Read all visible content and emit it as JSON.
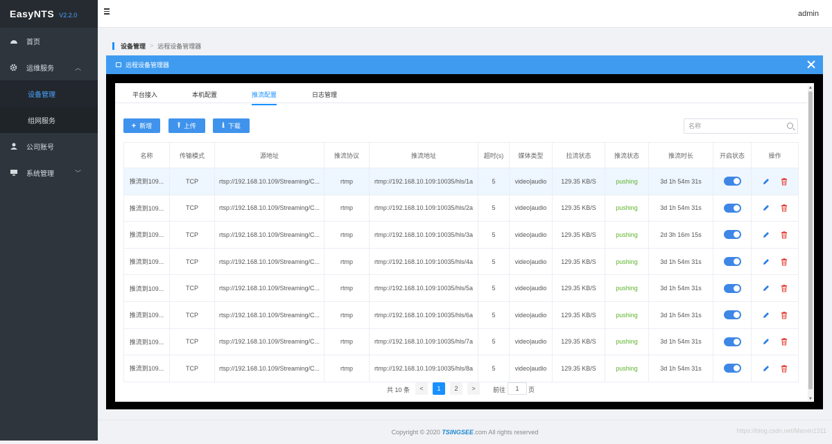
{
  "app": {
    "name": "EasyNTS",
    "version": "V2.2.0"
  },
  "sidebar": {
    "items": [
      {
        "label": "首页",
        "icon": "dashboard-icon"
      },
      {
        "label": "运维服务",
        "icon": "gear-icon"
      },
      {
        "label": "设备管理",
        "sub": true,
        "active": true
      },
      {
        "label": "组网服务",
        "sub": true
      },
      {
        "label": "公司账号",
        "icon": "user-icon"
      },
      {
        "label": "系统管理",
        "icon": "monitor-icon"
      }
    ]
  },
  "topbar": {
    "user": "admin",
    "menu_icon": "hamburger-icon"
  },
  "breadcrumb": {
    "first": "设备管理",
    "second": "远程设备管理器"
  },
  "dialog": {
    "title": "远程设备管理器"
  },
  "tabs": [
    {
      "label": "平台接入"
    },
    {
      "label": "本机配置"
    },
    {
      "label": "推流配置",
      "active": true
    },
    {
      "label": "日志管理"
    }
  ],
  "toolbar": {
    "add": "新增",
    "upload": "上传",
    "download": "下载"
  },
  "search": {
    "placeholder": "名称",
    "value": ""
  },
  "table": {
    "headers": [
      "名称",
      "传输模式",
      "源地址",
      "推流协议",
      "推流地址",
      "超时(s)",
      "媒体类型",
      "拉流状态",
      "推流状态",
      "推流时长",
      "开启状态",
      "操作"
    ],
    "rows": [
      [
        "推流到109...",
        "TCP",
        "rtsp://192.168.10.109/Streaming/C...",
        "rtmp",
        "rtmp://192.168.10.109:10035/hls/1a",
        "5",
        "video|audio",
        "129.35 KB/S",
        "pushing",
        "3d 1h 54m 31s"
      ],
      [
        "推流到109...",
        "TCP",
        "rtsp://192.168.10.109/Streaming/C...",
        "rtmp",
        "rtmp://192.168.10.109:10035/hls/2a",
        "5",
        "video|audio",
        "129.35 KB/S",
        "pushing",
        "3d 1h 54m 31s"
      ],
      [
        "推流到109...",
        "TCP",
        "rtsp://192.168.10.109/Streaming/C...",
        "rtmp",
        "rtmp://192.168.10.109:10035/hls/3a",
        "5",
        "video|audio",
        "129.35 KB/S",
        "pushing",
        "2d 3h 16m 15s"
      ],
      [
        "推流到109...",
        "TCP",
        "rtsp://192.168.10.109/Streaming/C...",
        "rtmp",
        "rtmp://192.168.10.109:10035/hls/4a",
        "5",
        "video|audio",
        "129.35 KB/S",
        "pushing",
        "3d 1h 54m 31s"
      ],
      [
        "推流到109...",
        "TCP",
        "rtsp://192.168.10.109/Streaming/C...",
        "rtmp",
        "rtmp://192.168.10.109:10035/hls/5a",
        "5",
        "video|audio",
        "129.35 KB/S",
        "pushing",
        "3d 1h 54m 31s"
      ],
      [
        "推流到109...",
        "TCP",
        "rtsp://192.168.10.109/Streaming/C...",
        "rtmp",
        "rtmp://192.168.10.109:10035/hls/6a",
        "5",
        "video|audio",
        "129.35 KB/S",
        "pushing",
        "3d 1h 54m 31s"
      ],
      [
        "推流到109...",
        "TCP",
        "rtsp://192.168.10.109/Streaming/C...",
        "rtmp",
        "rtmp://192.168.10.109:10035/hls/7a",
        "5",
        "video|audio",
        "129.35 KB/S",
        "pushing",
        "3d 1h 54m 31s"
      ],
      [
        "推流到109...",
        "TCP",
        "rtsp://192.168.10.109/Streaming/C...",
        "rtmp",
        "rtmp://192.168.10.109:10035/hls/8a",
        "5",
        "video|audio",
        "129.35 KB/S",
        "pushing",
        "3d 1h 54m 31s"
      ]
    ]
  },
  "pagination": {
    "total": "共 10 条",
    "prev": "<",
    "pages": [
      "1",
      "2"
    ],
    "next": ">",
    "goto": "前往",
    "page_value": "1",
    "page_unit": "页"
  },
  "footer": {
    "prefix": "Copyright © 2020 ",
    "brand": "TSINGSEE",
    "suffix": ".com All rights reserved"
  },
  "watermark": "https://blog.csdn.net/Marvin1311",
  "colors": {
    "primary": "#1890ff",
    "header_blue": "#3f9bf0",
    "sidebar": "#2f353d",
    "pushing": "#5cb32a",
    "delete": "#e5473c"
  }
}
